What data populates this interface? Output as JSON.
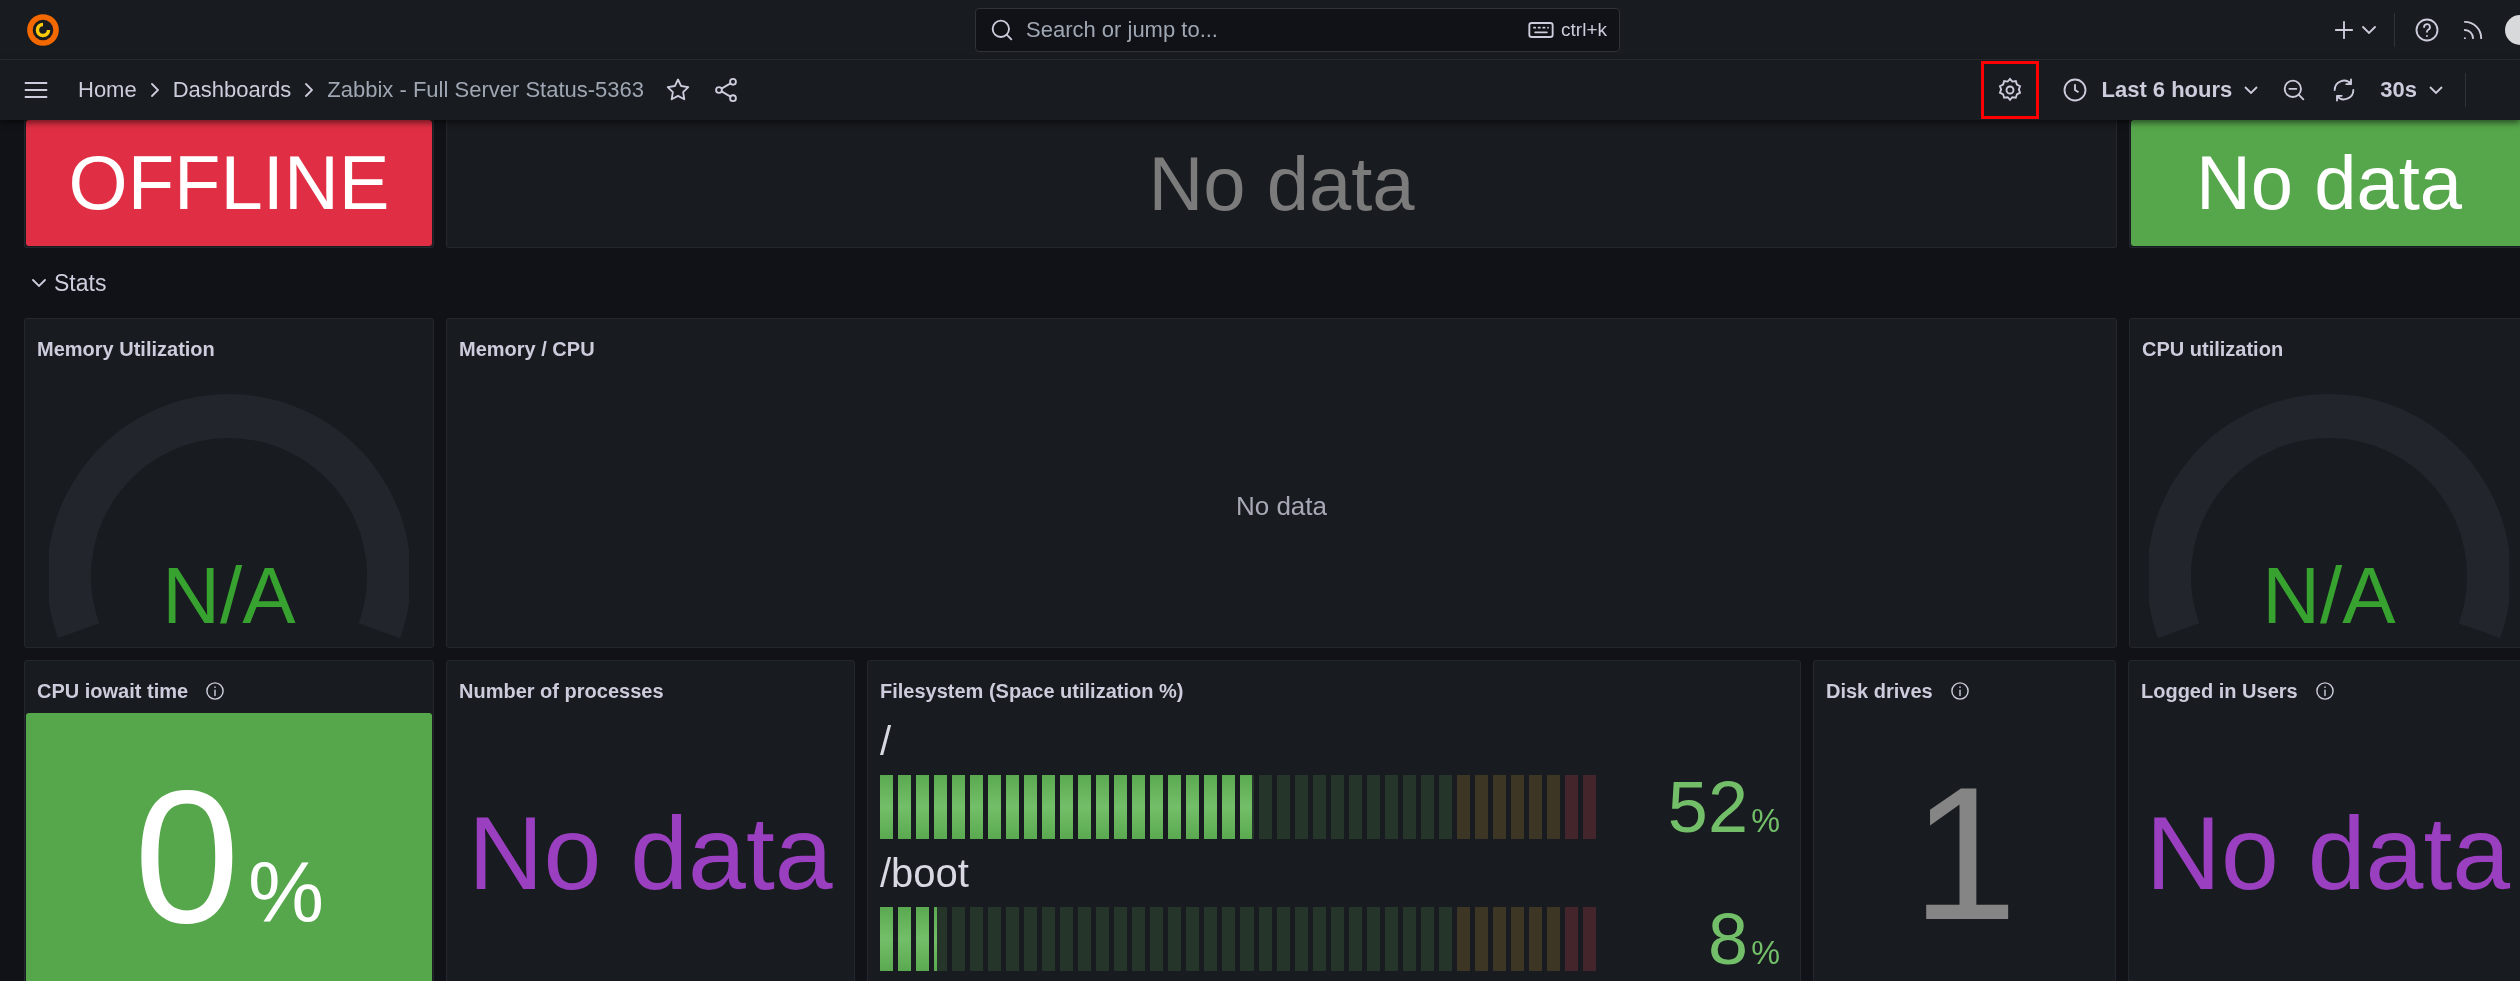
{
  "topbar": {
    "search": {
      "placeholder": "Search or jump to...",
      "shortcut": "ctrl+k"
    }
  },
  "navbar": {
    "breadcrumbs": [
      "Home",
      "Dashboards",
      "Zabbix - Full Server Status-5363"
    ],
    "settings_highlighted": true,
    "time_range": "Last 6 hours",
    "refresh": "30s"
  },
  "top_row": [
    {
      "kind": "tile",
      "value": "OFFLINE",
      "color": "#e02f44"
    },
    {
      "kind": "stat",
      "value": "No data",
      "color": "#7b7b7b"
    },
    {
      "kind": "tile",
      "value": "No data",
      "color": "#56a64b"
    }
  ],
  "section": {
    "title": "Stats",
    "expanded": true
  },
  "stats_rows": [
    [
      {
        "title": "Memory Utilization",
        "info": false,
        "kind": "gauge",
        "value": "N/A",
        "color": "#37a22f"
      },
      {
        "title": "Memory / CPU",
        "info": false,
        "kind": "timeseries",
        "value": "No data"
      },
      {
        "title": "CPU utilization",
        "info": false,
        "kind": "gauge",
        "value": "N/A",
        "color": "#37a22f"
      }
    ],
    [
      {
        "title": "CPU iowait time",
        "info": true,
        "kind": "tile",
        "value": "0",
        "unit": "%",
        "color": "#56a64b"
      },
      {
        "title": "Number of processes",
        "info": false,
        "kind": "stat",
        "value": "No data",
        "color": "#9a3fc0"
      },
      {
        "title": "Filesystem (Space utilization %)",
        "info": false,
        "kind": "bargauge",
        "bars": [
          {
            "label": "/",
            "level": 0.52,
            "value": "52",
            "unit": "%"
          },
          {
            "label": "/boot",
            "level": 0.08,
            "value": "8",
            "unit": "%"
          }
        ]
      },
      {
        "title": "Disk drives",
        "info": true,
        "kind": "stat",
        "value": "1",
        "color": "#858585"
      },
      {
        "title": "Logged in Users",
        "info": true,
        "kind": "stat",
        "value": "No data",
        "color": "#9a3fc0"
      }
    ]
  ]
}
